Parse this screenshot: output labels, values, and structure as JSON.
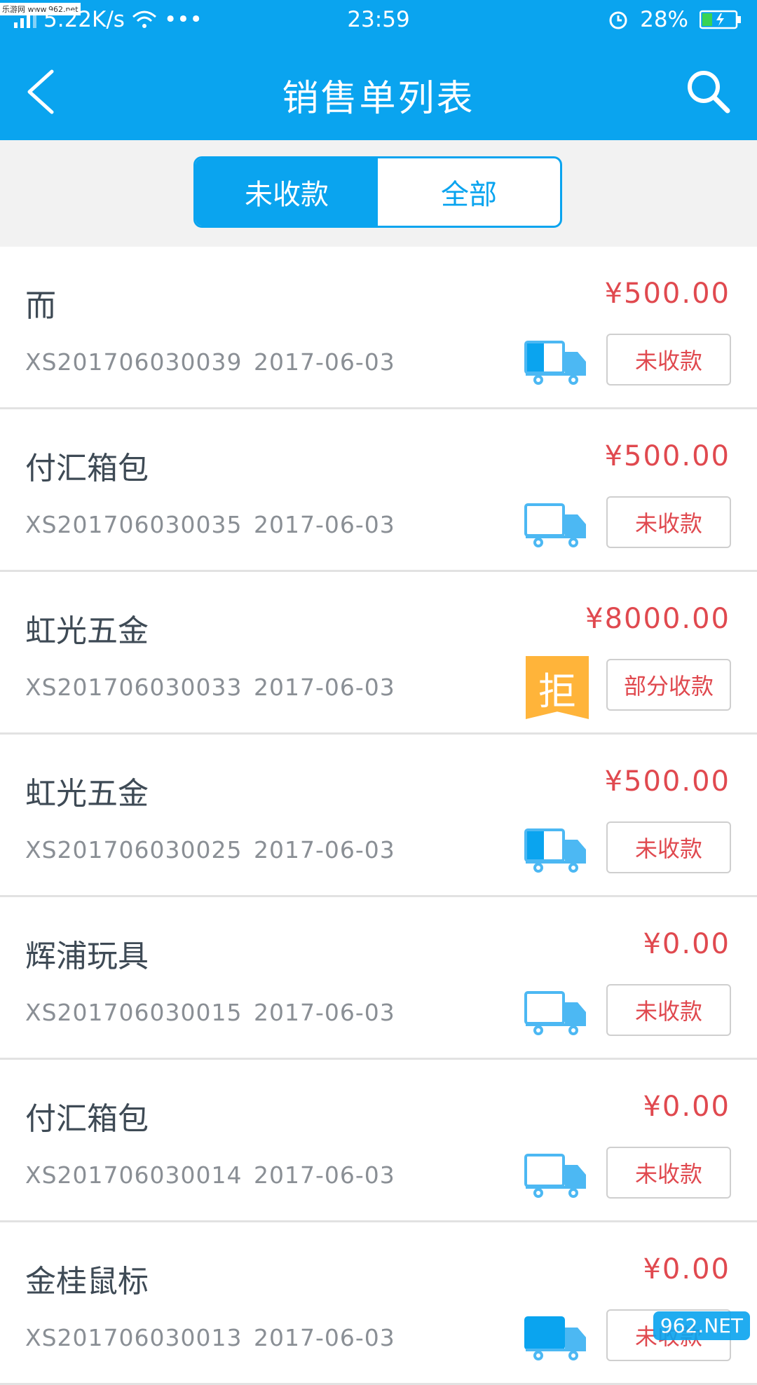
{
  "status_bar": {
    "watermark": "乐游网 www.962.net",
    "network": "5.22K/s",
    "time": "23:59",
    "battery": "28%"
  },
  "nav": {
    "title": "销售单列表"
  },
  "segments": {
    "unpaid": "未收款",
    "all": "全部"
  },
  "orders": [
    {
      "name": "而",
      "amount": "¥500.00",
      "order_no": "XS201706030039",
      "date": "2017-06-03",
      "icon": "truck-half-icon",
      "status": "未收款"
    },
    {
      "name": "付汇箱包",
      "amount": "¥500.00",
      "order_no": "XS201706030035",
      "date": "2017-06-03",
      "icon": "truck-empty-icon",
      "status": "未收款"
    },
    {
      "name": "虹光五金",
      "amount": "¥8000.00",
      "order_no": "XS201706030033",
      "date": "2017-06-03",
      "icon": "reject-badge-icon",
      "badge": "拒",
      "status": "部分收款"
    },
    {
      "name": "虹光五金",
      "amount": "¥500.00",
      "order_no": "XS201706030025",
      "date": "2017-06-03",
      "icon": "truck-half-icon",
      "status": "未收款"
    },
    {
      "name": "辉浦玩具",
      "amount": "¥0.00",
      "order_no": "XS201706030015",
      "date": "2017-06-03",
      "icon": "truck-empty-icon",
      "status": "未收款"
    },
    {
      "name": "付汇箱包",
      "amount": "¥0.00",
      "order_no": "XS201706030014",
      "date": "2017-06-03",
      "icon": "truck-empty-icon",
      "status": "未收款"
    },
    {
      "name": "金桂鼠标",
      "amount": "¥0.00",
      "order_no": "XS201706030013",
      "date": "2017-06-03",
      "icon": "truck-full-icon",
      "status": "未收款"
    }
  ],
  "corner_logo": "962.NET"
}
